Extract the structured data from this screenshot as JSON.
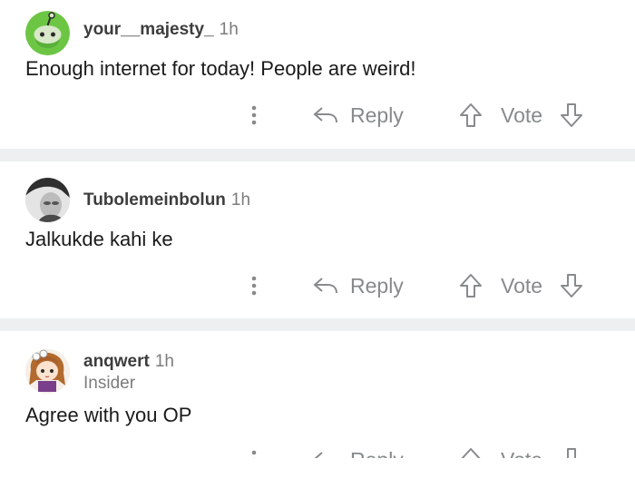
{
  "comments": [
    {
      "username": "your__majesty_",
      "time": "1h",
      "flair": "",
      "text": "Enough internet for today! People are weird!",
      "avatar": "snoo-avatar",
      "actions": {
        "reply_label": "Reply",
        "vote_label": "Vote"
      }
    },
    {
      "username": "Tubolemeinbolun",
      "time": "1h",
      "flair": "",
      "text": "Jalkukde kahi ke",
      "avatar": "photo-avatar",
      "actions": {
        "reply_label": "Reply",
        "vote_label": "Vote"
      }
    },
    {
      "username": "anqwert",
      "time": "1h",
      "flair": "Insider",
      "text": "Agree with you OP",
      "avatar": "anime-girl-avatar",
      "actions": {
        "reply_label": "Reply",
        "vote_label": "Vote"
      }
    }
  ],
  "colors": {
    "background": "#ffffff",
    "divider": "#edeff1",
    "username": "#3d3d3d",
    "meta": "#7c7c7c",
    "action": "#878a8c",
    "snoo_green": "#6cc644"
  },
  "icons": [
    "more-vertical-icon",
    "reply-arrow-icon",
    "upvote-icon",
    "downvote-icon"
  ]
}
